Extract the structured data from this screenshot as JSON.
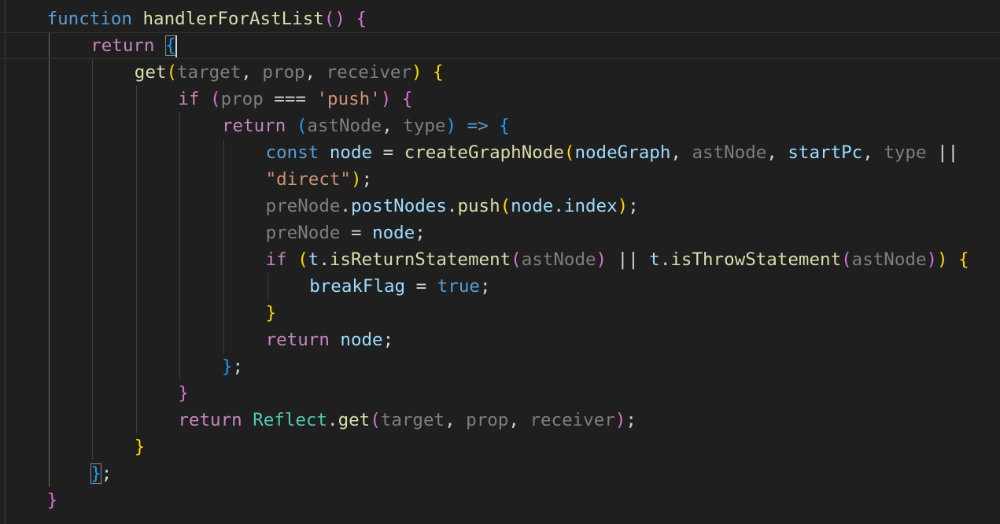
{
  "theme": {
    "background": "#1f1f1f",
    "current_line_border": "#303030",
    "indent_guide": "#404040",
    "active_indent_guide": "#707070",
    "token_colors": {
      "keyword": "#569cd6",
      "control": "#c586c0",
      "function": "#dcdcaa",
      "variable": "#9cdcfe",
      "unused": "#7e7e7e",
      "string": "#ce9178",
      "plain": "#d4d4d4",
      "class": "#4ec9b0",
      "bracket1": "#ffd700",
      "bracket2": "#da70d6",
      "bracket3": "#179fff"
    }
  },
  "editor": {
    "cursor_line": 2,
    "lines": [
      {
        "indent": 1,
        "tokens": [
          [
            "function",
            "keyword"
          ],
          [
            " ",
            "plain"
          ],
          [
            "handlerForAstList",
            "function"
          ],
          [
            "()",
            "bracket2"
          ],
          [
            " ",
            "plain"
          ],
          [
            "{",
            "bracket2"
          ]
        ]
      },
      {
        "indent": 2,
        "tokens": [
          [
            "return",
            "control"
          ],
          [
            " ",
            "plain"
          ],
          [
            "{",
            "bracket3",
            "match"
          ]
        ]
      },
      {
        "indent": 3,
        "tokens": [
          [
            "get",
            "function"
          ],
          [
            "(",
            "bracket1"
          ],
          [
            "target",
            "unused"
          ],
          [
            ", ",
            "plain"
          ],
          [
            "prop",
            "unused"
          ],
          [
            ", ",
            "plain"
          ],
          [
            "receiver",
            "unused"
          ],
          [
            ")",
            "bracket1"
          ],
          [
            " ",
            "plain"
          ],
          [
            "{",
            "bracket1"
          ]
        ]
      },
      {
        "indent": 4,
        "tokens": [
          [
            "if",
            "control"
          ],
          [
            " ",
            "plain"
          ],
          [
            "(",
            "bracket2"
          ],
          [
            "prop",
            "unused"
          ],
          [
            " === ",
            "plain"
          ],
          [
            "'push'",
            "string"
          ],
          [
            ")",
            "bracket2"
          ],
          [
            " ",
            "plain"
          ],
          [
            "{",
            "bracket2"
          ]
        ]
      },
      {
        "indent": 5,
        "tokens": [
          [
            "return",
            "control"
          ],
          [
            " ",
            "plain"
          ],
          [
            "(",
            "bracket3"
          ],
          [
            "astNode",
            "unused"
          ],
          [
            ", ",
            "plain"
          ],
          [
            "type",
            "unused"
          ],
          [
            ")",
            "bracket3"
          ],
          [
            " ",
            "plain"
          ],
          [
            "=>",
            "keyword"
          ],
          [
            " ",
            "plain"
          ],
          [
            "{",
            "bracket3"
          ]
        ]
      },
      {
        "indent": 6,
        "tokens": [
          [
            "const",
            "keyword"
          ],
          [
            " ",
            "plain"
          ],
          [
            "node",
            "variable"
          ],
          [
            " = ",
            "plain"
          ],
          [
            "createGraphNode",
            "function"
          ],
          [
            "(",
            "bracket1"
          ],
          [
            "nodeGraph",
            "variable"
          ],
          [
            ", ",
            "plain"
          ],
          [
            "astNode",
            "unused"
          ],
          [
            ", ",
            "plain"
          ],
          [
            "startPc",
            "variable"
          ],
          [
            ", ",
            "plain"
          ],
          [
            "type",
            "unused"
          ],
          [
            " ||",
            "plain"
          ]
        ]
      },
      {
        "indent": 6,
        "tokens": [
          [
            "\"direct\"",
            "string"
          ],
          [
            ")",
            "bracket1"
          ],
          [
            ";",
            "plain"
          ]
        ]
      },
      {
        "indent": 6,
        "tokens": [
          [
            "preNode",
            "unused"
          ],
          [
            ".",
            "plain"
          ],
          [
            "postNodes",
            "variable"
          ],
          [
            ".",
            "plain"
          ],
          [
            "push",
            "function"
          ],
          [
            "(",
            "bracket1"
          ],
          [
            "node",
            "variable"
          ],
          [
            ".",
            "plain"
          ],
          [
            "index",
            "variable"
          ],
          [
            ")",
            "bracket1"
          ],
          [
            ";",
            "plain"
          ]
        ]
      },
      {
        "indent": 6,
        "tokens": [
          [
            "preNode",
            "unused"
          ],
          [
            " = ",
            "plain"
          ],
          [
            "node",
            "variable"
          ],
          [
            ";",
            "plain"
          ]
        ]
      },
      {
        "indent": 6,
        "tokens": [
          [
            "if",
            "control"
          ],
          [
            " ",
            "plain"
          ],
          [
            "(",
            "bracket1"
          ],
          [
            "t",
            "variable"
          ],
          [
            ".",
            "plain"
          ],
          [
            "isReturnStatement",
            "function"
          ],
          [
            "(",
            "bracket2"
          ],
          [
            "astNode",
            "unused"
          ],
          [
            ")",
            "bracket2"
          ],
          [
            " || ",
            "plain"
          ],
          [
            "t",
            "variable"
          ],
          [
            ".",
            "plain"
          ],
          [
            "isThrowStatement",
            "function"
          ],
          [
            "(",
            "bracket2"
          ],
          [
            "astNode",
            "unused"
          ],
          [
            ")",
            "bracket2"
          ],
          [
            ")",
            "bracket1"
          ],
          [
            " ",
            "plain"
          ],
          [
            "{",
            "bracket1"
          ]
        ]
      },
      {
        "indent": 7,
        "tokens": [
          [
            "breakFlag",
            "variable"
          ],
          [
            " = ",
            "plain"
          ],
          [
            "true",
            "keyword"
          ],
          [
            ";",
            "plain"
          ]
        ]
      },
      {
        "indent": 6,
        "tokens": [
          [
            "}",
            "bracket1"
          ]
        ]
      },
      {
        "indent": 6,
        "tokens": [
          [
            "return",
            "control"
          ],
          [
            " ",
            "plain"
          ],
          [
            "node",
            "variable"
          ],
          [
            ";",
            "plain"
          ]
        ]
      },
      {
        "indent": 5,
        "tokens": [
          [
            "}",
            "bracket3"
          ],
          [
            ";",
            "plain"
          ]
        ]
      },
      {
        "indent": 4,
        "tokens": [
          [
            "}",
            "bracket2"
          ]
        ]
      },
      {
        "indent": 4,
        "tokens": [
          [
            "return",
            "control"
          ],
          [
            " ",
            "plain"
          ],
          [
            "Reflect",
            "class"
          ],
          [
            ".",
            "plain"
          ],
          [
            "get",
            "function"
          ],
          [
            "(",
            "bracket2"
          ],
          [
            "target",
            "unused"
          ],
          [
            ", ",
            "plain"
          ],
          [
            "prop",
            "unused"
          ],
          [
            ", ",
            "plain"
          ],
          [
            "receiver",
            "unused"
          ],
          [
            ")",
            "bracket2"
          ],
          [
            ";",
            "plain"
          ]
        ]
      },
      {
        "indent": 3,
        "tokens": [
          [
            "}",
            "bracket1"
          ]
        ]
      },
      {
        "indent": 2,
        "tokens": [
          [
            "}",
            "bracket3",
            "match"
          ],
          [
            ";",
            "plain"
          ]
        ]
      },
      {
        "indent": 1,
        "tokens": [
          [
            "}",
            "bracket2"
          ]
        ]
      }
    ]
  }
}
